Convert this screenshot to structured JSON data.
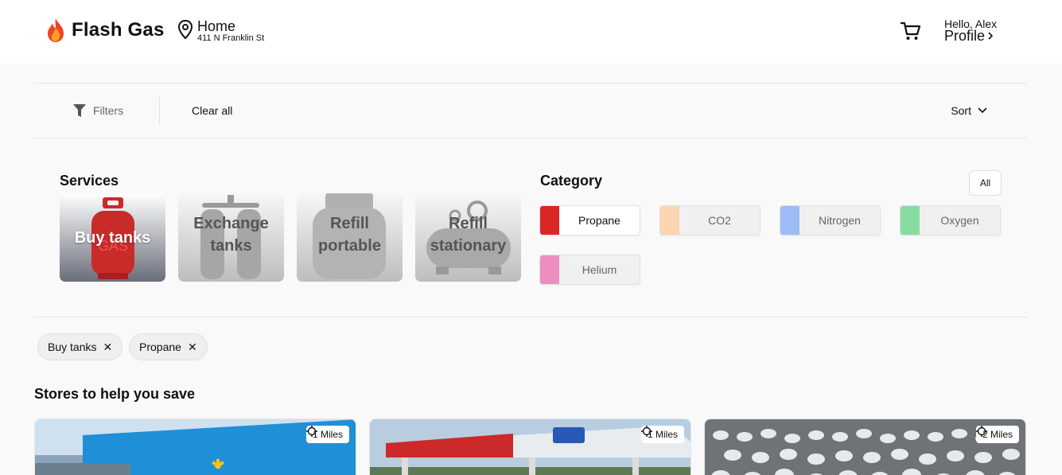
{
  "app": {
    "name": "Flash Gas",
    "brand_color": "#e8542b"
  },
  "header": {
    "location": {
      "title": "Home",
      "address": "411 N Franklin St"
    },
    "user": {
      "greeting": "Hello, Alex",
      "profile_label": "Profile"
    }
  },
  "filter_bar": {
    "filters_label": "Filters",
    "clear_all_label": "Clear all",
    "sort_label": "Sort"
  },
  "services": {
    "title": "Services",
    "items": [
      {
        "label": "Buy tanks",
        "active": true
      },
      {
        "label": "Exchange tanks",
        "active": false
      },
      {
        "label": "Refill portable",
        "active": false
      },
      {
        "label": "Refill stationary",
        "active": false
      }
    ]
  },
  "category": {
    "title": "Category",
    "all_label": "All",
    "items": [
      {
        "label": "Propane",
        "color": "#dc2626",
        "active": true
      },
      {
        "label": "CO2",
        "color": "#fbd5b0",
        "active": false
      },
      {
        "label": "Nitrogen",
        "color": "#9dbcf5",
        "active": false
      },
      {
        "label": "Oxygen",
        "color": "#86dca0",
        "active": false
      },
      {
        "label": "Helium",
        "color": "#ec8fc0",
        "active": false
      }
    ]
  },
  "applied_filters": [
    {
      "label": "Buy tanks"
    },
    {
      "label": "Propane"
    }
  ],
  "stores": {
    "title": "Stores to help you save",
    "items": [
      {
        "distance": "1 Miles",
        "icon": "location-target-icon"
      },
      {
        "distance": "1 Miles",
        "icon": "location-target-icon"
      },
      {
        "distance": "2 Miles",
        "icon": "location-target-icon"
      }
    ]
  }
}
